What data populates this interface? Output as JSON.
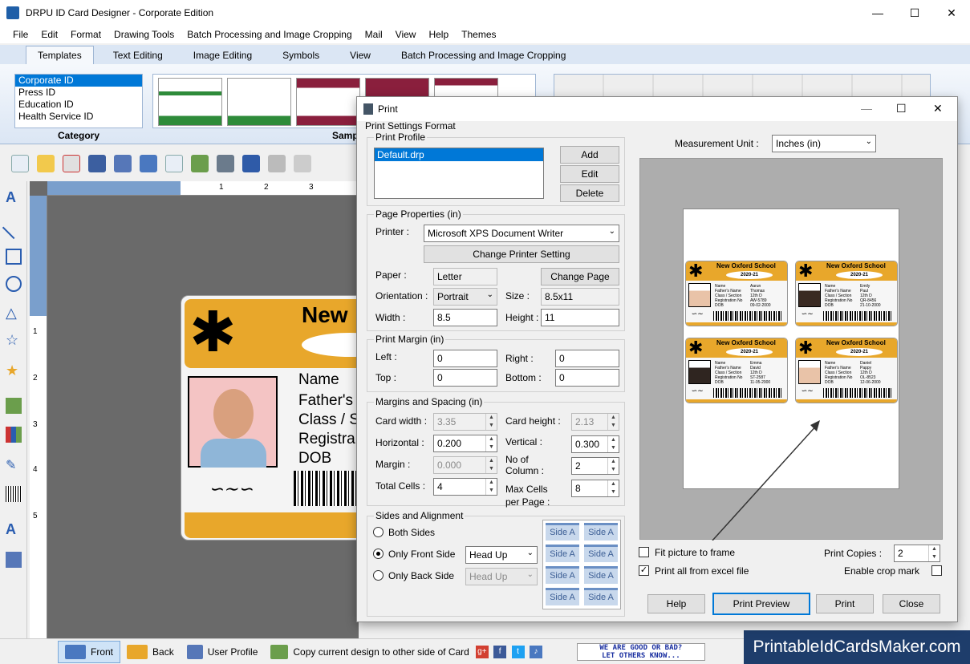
{
  "app": {
    "title": "DRPU ID Card Designer - Corporate Edition",
    "window_controls": [
      "—",
      "☐",
      "✕"
    ]
  },
  "menu": [
    "File",
    "Edit",
    "Format",
    "Drawing Tools",
    "Batch Processing and Image Cropping",
    "Mail",
    "View",
    "Help",
    "Themes"
  ],
  "ribbon_tabs": [
    "Templates",
    "Text Editing",
    "Image Editing",
    "Symbols",
    "View",
    "Batch Processing and Image Cropping"
  ],
  "ribbon": {
    "categories": [
      "Corporate ID",
      "Press ID",
      "Education ID",
      "Health Service ID"
    ],
    "category_label": "Category",
    "samples_label": "Samp"
  },
  "rulers": {
    "top": [
      "1",
      "2",
      "3"
    ],
    "left": [
      "1",
      "2",
      "3",
      "4",
      "5"
    ]
  },
  "card": {
    "school": "New",
    "fields": [
      "Name",
      "Father's",
      "Class / S",
      "Registra",
      "DOB"
    ]
  },
  "statusbar": {
    "front": "Front",
    "back": "Back",
    "user_profile": "User Profile",
    "copy_design": "Copy current design to other side of Card",
    "social": [
      "g+",
      "f",
      "t",
      "♪"
    ],
    "feedback_line1": "WE ARE GOOD OR BAD?",
    "feedback_line2": "LET OTHERS KNOW...",
    "brand": "PrintableIdCardsMaker.com"
  },
  "dialog": {
    "title": "Print",
    "print_settings_format": "Print Settings Format",
    "print_profile": {
      "label": "Print Profile",
      "items": [
        "Default.drp"
      ],
      "add": "Add",
      "edit": "Edit",
      "delete": "Delete"
    },
    "page_properties": {
      "label": "Page Properties  (in)",
      "printer_label": "Printer :",
      "printer_value": "Microsoft XPS Document Writer",
      "change_printer": "Change Printer Setting",
      "paper_label": "Paper :",
      "paper_value": "Letter",
      "change_page": "Change Page",
      "orientation_label": "Orientation :",
      "orientation_value": "Portrait",
      "size_label": "Size :",
      "size_value": "8.5x11",
      "width_label": "Width :",
      "width_value": "8.5",
      "height_label": "Height :",
      "height_value": "11"
    },
    "print_margin": {
      "label": "Print Margin  (in)",
      "left_label": "Left :",
      "left_value": "0",
      "right_label": "Right :",
      "right_value": "0",
      "top_label": "Top :",
      "top_value": "0",
      "bottom_label": "Bottom :",
      "bottom_value": "0"
    },
    "margins_spacing": {
      "label": "Margins and Spacing  (in)",
      "card_width_label": "Card width :",
      "card_width_value": "3.35",
      "card_height_label": "Card height :",
      "card_height_value": "2.13",
      "horizontal_label": "Horizontal :",
      "horizontal_value": "0.200",
      "vertical_label": "Vertical :",
      "vertical_value": "0.300",
      "margin_label": "Margin :",
      "margin_value": "0.000",
      "no_of_column_label1": "No of",
      "no_of_column_label2": "Column :",
      "no_of_column_value": "2",
      "total_cells_label": "Total Cells :",
      "total_cells_value": "4",
      "max_cells_label1": "Max Cells",
      "max_cells_label2": "per Page :",
      "max_cells_value": "8"
    },
    "sides_alignment": {
      "label": "Sides and Alignment",
      "both_sides": "Both Sides",
      "only_front": "Only Front Side",
      "only_back": "Only Back Side",
      "front_align": "Head Up",
      "back_align": "Head Up",
      "cell_label": "Side A"
    },
    "measurement_label": "Measurement Unit :",
    "measurement_value": "Inches (in)",
    "fit_picture": "Fit picture to frame",
    "print_all_excel": "Print all from excel file",
    "print_copies_label": "Print Copies :",
    "print_copies_value": "2",
    "enable_crop": "Enable crop mark",
    "buttons": {
      "help": "Help",
      "print_preview": "Print Preview",
      "print": "Print",
      "close": "Close"
    },
    "preview_cards": [
      {
        "school": "New Oxford School",
        "year": "2020-21",
        "name": "Aarun",
        "father": "Thomas",
        "class": "12th D",
        "reg": "AW-5789",
        "dob": "09-02-2000"
      },
      {
        "school": "New Oxford School",
        "year": "2020-21",
        "name": "Emily",
        "father": "Paul",
        "class": "12th D",
        "reg": "QR-8456",
        "dob": "21-10-2000"
      },
      {
        "school": "New Oxford School",
        "year": "2020-21",
        "name": "Emma",
        "father": "David",
        "class": "12th D",
        "reg": "ST-2587",
        "dob": "11-05-2000"
      },
      {
        "school": "New Oxford School",
        "year": "2020-21",
        "name": "Daniel",
        "father": "Pappy",
        "class": "12th D",
        "reg": "OL-8523",
        "dob": "12-06-2000"
      }
    ],
    "preview_field_labels": [
      "Name",
      "Father's Name",
      "Class / Section",
      "Registration No",
      "DOB"
    ]
  }
}
